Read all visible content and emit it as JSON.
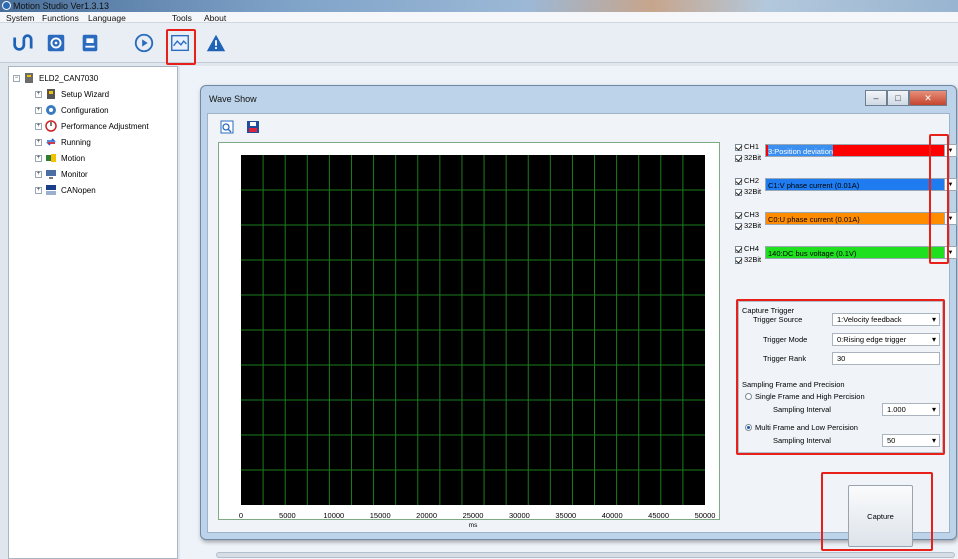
{
  "app": {
    "title": "Motion Studio  Ver1.3.13"
  },
  "menu": {
    "items": [
      "System",
      "Functions",
      "Language",
      "Tools",
      "About"
    ]
  },
  "toolbar": {
    "icons": [
      "motor-icon",
      "config-icon",
      "document-icon",
      "play-icon",
      "wave-icon",
      "warning-icon"
    ],
    "highlighted": "wave-icon"
  },
  "tree": {
    "root": "ELD2_CAN7030",
    "items": [
      {
        "label": "Setup Wizard",
        "icon": "wizard-icon"
      },
      {
        "label": "Configuration",
        "icon": "gear-icon"
      },
      {
        "label": "Performance Adjustment",
        "icon": "performance-icon"
      },
      {
        "label": "Running",
        "icon": "running-icon"
      },
      {
        "label": "Motion",
        "icon": "motion-icon"
      },
      {
        "label": "Monitor",
        "icon": "monitor-icon"
      },
      {
        "label": "CANopen",
        "icon": "canopen-icon"
      }
    ]
  },
  "wave_window": {
    "title": "Wave Show",
    "x_ticks": [
      "0",
      "5000",
      "10000",
      "15000",
      "20000",
      "25000",
      "30000",
      "35000",
      "40000",
      "45000",
      "50000"
    ],
    "x_unit": "ms",
    "grid": {
      "vertical_lines": 21,
      "horizontal_lines": 10,
      "color": "#1a7d1a",
      "background": "#000000"
    },
    "channels": [
      {
        "label": "CH1",
        "bit": "32Bit",
        "value": "3:Position deviation",
        "color": "#ff0000"
      },
      {
        "label": "CH2",
        "bit": "32Bit",
        "value": "C1:V phase current (0.01A)",
        "color": "#1e7cf0"
      },
      {
        "label": "CH3",
        "bit": "32Bit",
        "value": "C0:U phase current (0.01A)",
        "color": "#ff8c00"
      },
      {
        "label": "CH4",
        "bit": "32Bit",
        "value": "140:DC bus voltage (0.1V)",
        "color": "#1fe01f"
      }
    ],
    "capture_trigger": {
      "title": "Capture Trigger",
      "trigger_source_label": "Trigger Source",
      "trigger_source_value": "1:Velocity feedback",
      "trigger_mode_label": "Trigger Mode",
      "trigger_mode_value": "0:Rising edge trigger",
      "trigger_rank_label": "Trigger Rank",
      "trigger_rank_value": "30"
    },
    "sampling": {
      "title": "Sampling Frame and Precision",
      "option1": "Single Frame and High Percision",
      "interval_label_1": "Sampling Interval",
      "interval_value_1": "1.000",
      "option2": "Multi Frame and Low Percision",
      "interval_label_2": "Sampling Interval",
      "interval_value_2": "50",
      "selected": 2
    },
    "capture_button": "Capture"
  }
}
